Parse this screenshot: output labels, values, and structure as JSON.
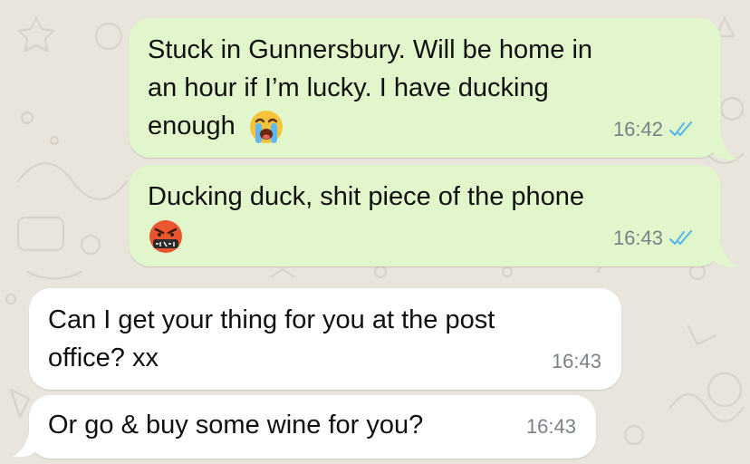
{
  "chat": {
    "messages": [
      {
        "direction": "outgoing",
        "lines": [
          "Stuck in Gunnersbury. Will be home in",
          "an hour if I’m lucky. I have ducking",
          "enough"
        ],
        "emoji": "loudly-crying-face",
        "time": "16:42",
        "status": "read"
      },
      {
        "direction": "outgoing",
        "lines": [
          "Ducking duck, shit piece of the phone"
        ],
        "emoji": "face-with-symbols-on-mouth",
        "time": "16:43",
        "status": "read"
      },
      {
        "direction": "incoming",
        "lines": [
          "Can I get your thing for you at the post",
          "office? xx"
        ],
        "time": "16:43"
      },
      {
        "direction": "incoming",
        "lines": [
          "Or go & buy some wine for you?"
        ],
        "time": "16:43"
      }
    ]
  },
  "colors": {
    "wallpaper": "#e9e4dc",
    "outgoing_bubble": "#e1f7cb",
    "incoming_bubble": "#ffffff",
    "read_ticks": "#4fb6ec",
    "timestamp": "#7b8188"
  }
}
